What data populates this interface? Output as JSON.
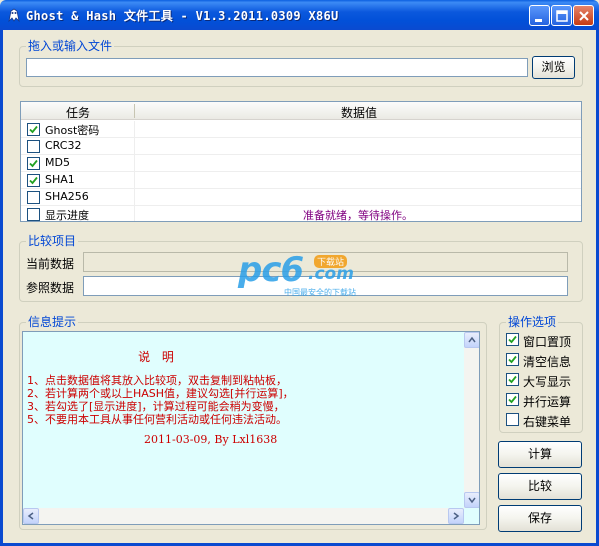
{
  "window": {
    "title": "Ghost & Hash 文件工具 - V1.3.2011.0309 X86U",
    "colors": {
      "titlebar": "#0a58dd",
      "group_label": "#0046d5",
      "info_bg": "#e0fefe",
      "info_text": "#cc0000",
      "status_text": "#800080"
    }
  },
  "file_group": {
    "label": "拖入或输入文件",
    "input_value": "",
    "browse_label": "浏览"
  },
  "task_table": {
    "headers": [
      "任务",
      "数据值"
    ],
    "rows": [
      {
        "name": "Ghost密码",
        "checked": true,
        "value": ""
      },
      {
        "name": "CRC32",
        "checked": false,
        "value": ""
      },
      {
        "name": "MD5",
        "checked": true,
        "value": ""
      },
      {
        "name": "SHA1",
        "checked": true,
        "value": ""
      },
      {
        "name": "SHA256",
        "checked": false,
        "value": ""
      },
      {
        "name": "显示进度",
        "checked": false,
        "value": "准备就绪，等待操作。"
      }
    ]
  },
  "compare_group": {
    "label": "比较项目",
    "current_label": "当前数据",
    "current_value": "",
    "reference_label": "参照数据",
    "reference_value": ""
  },
  "watermark": {
    "logo_text": "pc6",
    "suffix": ".com",
    "badge": "下载站",
    "slogan": "中国最安全的下载站"
  },
  "info_group": {
    "label": "信息提示",
    "heading": "说 明",
    "lines": [
      "1、点击数据值将其放入比较项，双击复制到粘帖板，",
      "2、若计算两个或以上HASH值，建议勾选[并行运算]，",
      "3、若勾选了[显示进度]，计算过程可能会稍为变慢，",
      "5、不要用本工具从事任何营利活动或任何违法活动。"
    ],
    "footer": "2011-03-09, By Lxl1638"
  },
  "options_group": {
    "label": "操作选项",
    "items": [
      {
        "label": "窗口置顶",
        "checked": true
      },
      {
        "label": "清空信息",
        "checked": true
      },
      {
        "label": "大写显示",
        "checked": true
      },
      {
        "label": "并行运算",
        "checked": true
      },
      {
        "label": "右键菜单",
        "checked": false
      }
    ]
  },
  "actions": {
    "calc": "计算",
    "compare": "比较",
    "save": "保存"
  }
}
